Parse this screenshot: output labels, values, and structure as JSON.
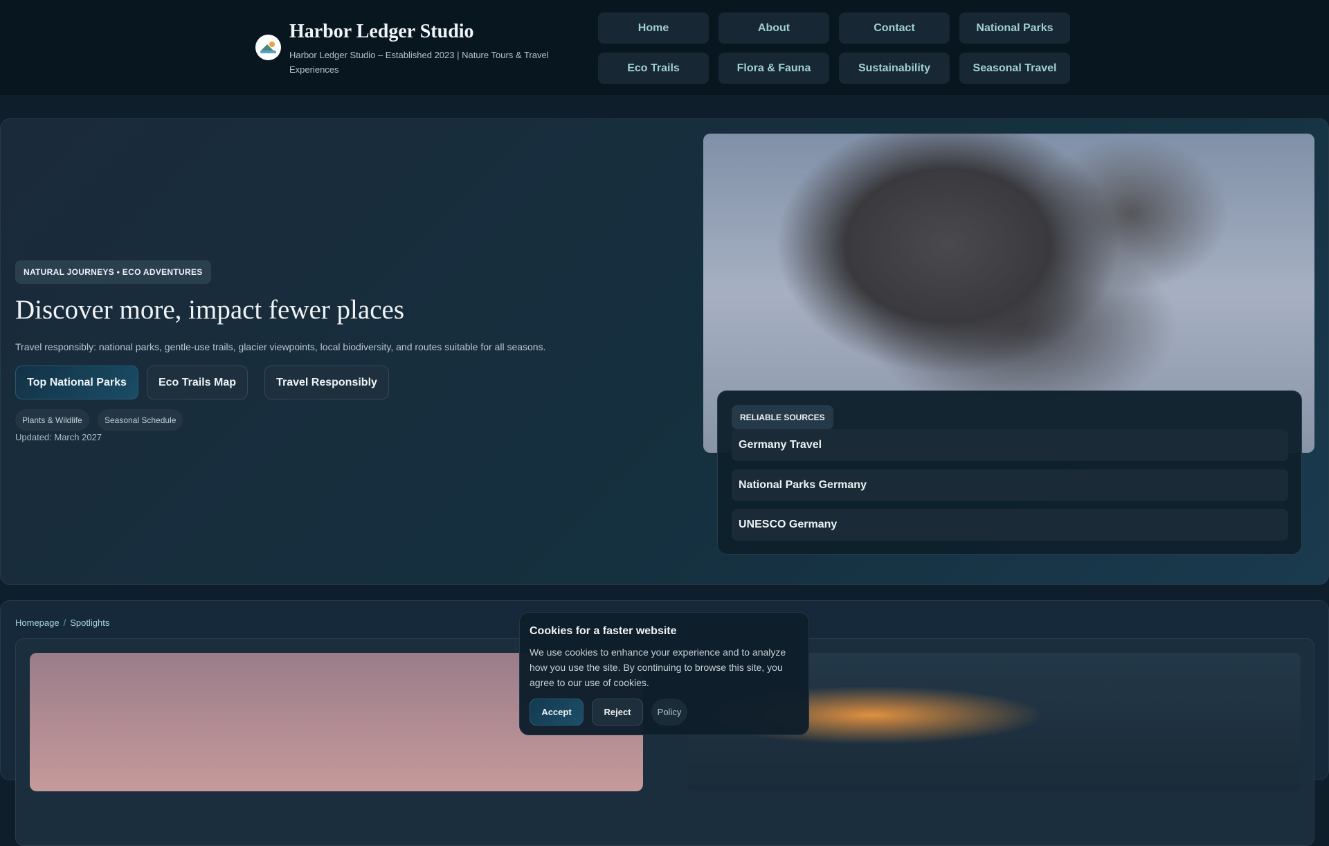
{
  "header": {
    "title": "Harbor Ledger Studio",
    "subtitle": "Harbor Ledger Studio – Established 2023 | Nature Tours & Travel Experiences",
    "nav": [
      "Home",
      "About",
      "Contact",
      "National Parks",
      "Eco Trails",
      "Flora & Fauna",
      "Sustainability",
      "Seasonal Travel"
    ]
  },
  "hero": {
    "eyebrow": "NATURAL JOURNEYS • ECO ADVENTURES",
    "title": "Discover more, impact fewer places",
    "description": "Travel responsibly: national parks, gentle-use trails, glacier viewpoints, local biodiversity, and routes suitable for all seasons.",
    "buttons": [
      "Top National Parks",
      "Eco Trails Map",
      "Travel Responsibly"
    ],
    "chips": [
      "Plants & Wildlife",
      "Seasonal Schedule"
    ],
    "updated": "Updated: March 2027"
  },
  "sources": {
    "badge": "RELIABLE SOURCES",
    "items": [
      "Germany Travel",
      "National Parks Germany",
      "UNESCO Germany"
    ]
  },
  "breadcrumb": [
    "Homepage",
    "Spotlights"
  ],
  "cookie": {
    "title": "Cookies for a faster website",
    "text": "We use cookies to enhance your experience and to analyze how you use the site. By continuing to browse this site, you agree to our use of cookies.",
    "accept": "Accept",
    "reject": "Reject",
    "policy": "Policy"
  }
}
